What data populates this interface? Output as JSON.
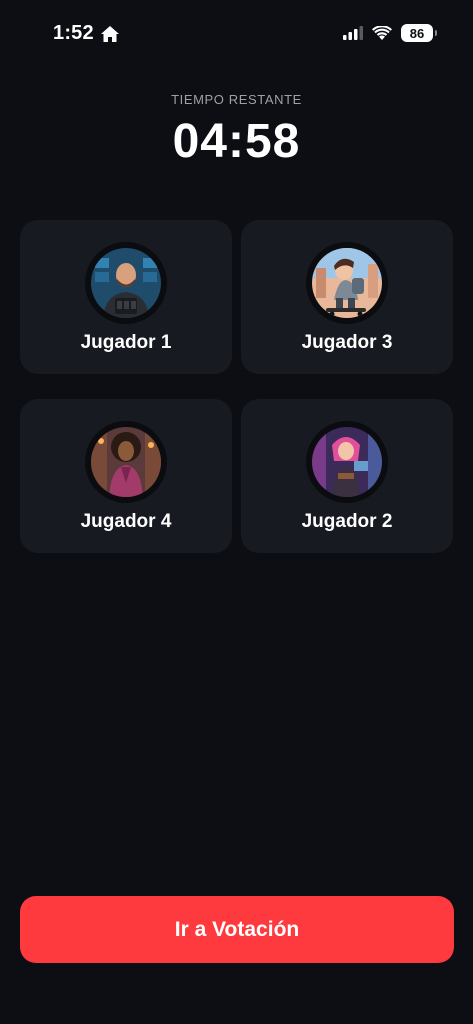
{
  "status_bar": {
    "time": "1:52",
    "battery": "86",
    "icons": [
      "home-icon",
      "signal-icon",
      "wifi-icon",
      "battery-icon"
    ]
  },
  "timer": {
    "label": "TIEMPO RESTANTE",
    "value": "04:58"
  },
  "players": [
    {
      "name": "Jugador 1",
      "avatar": "bald-man-tactical-vest-avatar"
    },
    {
      "name": "Jugador 3",
      "avatar": "boy-skateboard-backpack-avatar"
    },
    {
      "name": "Jugador 4",
      "avatar": "woman-curly-hair-pink-coat-avatar"
    },
    {
      "name": "Jugador 2",
      "avatar": "girl-pink-hair-hologram-avatar"
    }
  ],
  "actions": {
    "vote_label": "Ir a Votación",
    "accent_color": "#fe3a3f"
  },
  "colors": {
    "background": "#0d0e14",
    "card": "#181a22"
  }
}
